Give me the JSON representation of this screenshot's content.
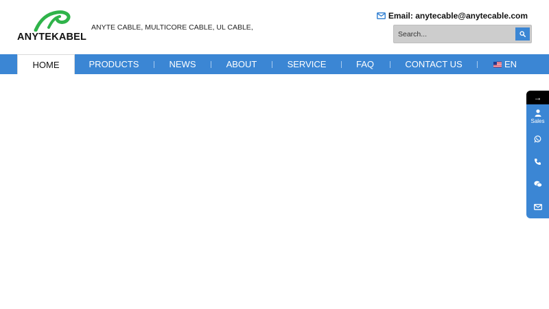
{
  "header": {
    "logo_text": "ANYTEKABEL",
    "tagline": "ANYTE CABLE, MULTICORE CABLE, UL CABLE,",
    "email_text": "Email: anytecable@anytecable.com",
    "search": {
      "placeholder": "Search..."
    }
  },
  "nav": {
    "items": [
      {
        "label": "HOME"
      },
      {
        "label": "PRODUCTS"
      },
      {
        "label": "NEWS"
      },
      {
        "label": "ABOUT"
      },
      {
        "label": "SERVICE"
      },
      {
        "label": "FAQ"
      },
      {
        "label": "CONTACT US"
      },
      {
        "label": "EN"
      }
    ]
  },
  "float_bar": {
    "collapse_glyph": "→",
    "sales_label": "Sales",
    "icons": [
      "user-icon",
      "whatsapp-icon",
      "phone-icon",
      "wechat-icon",
      "envelope-icon"
    ]
  },
  "colors": {
    "accent": "#3b86d4",
    "logo_green": "#2fb34a",
    "float_top": "#000000"
  }
}
